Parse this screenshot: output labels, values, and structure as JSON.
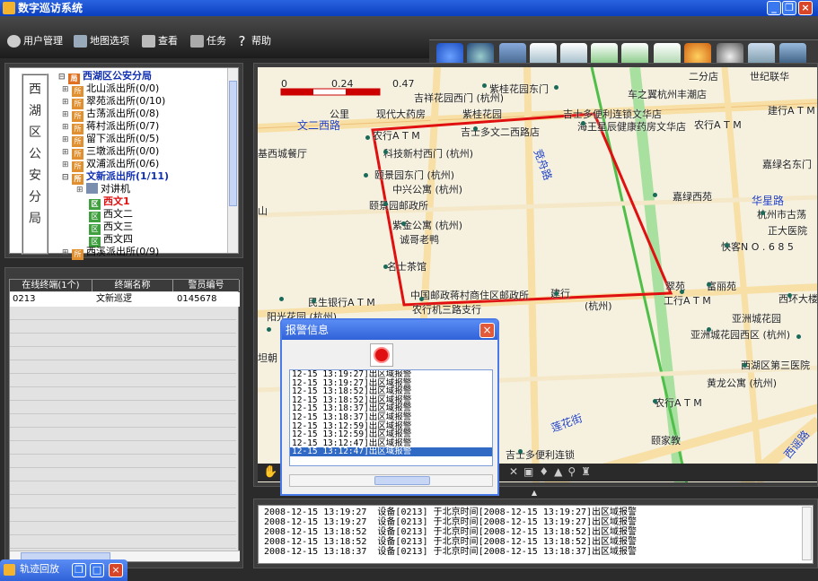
{
  "window": {
    "title": "数字巡访系统"
  },
  "menu": {
    "user_mgmt": "用户管理",
    "map_options": "地图选项",
    "view": "查看",
    "task": "任务",
    "help": "帮助"
  },
  "sidebar": {
    "vertical_label": "西湖区公安分局",
    "root": "西湖区公安分局",
    "items": [
      {
        "label": "北山派出所(0/0)"
      },
      {
        "label": "翠苑派出所(0/10)"
      },
      {
        "label": "古荡派出所(0/8)"
      },
      {
        "label": "蒋村派出所(0/7)"
      },
      {
        "label": "留下派出所(0/5)"
      },
      {
        "label": "三墩派出所(0/0)"
      },
      {
        "label": "双浦派出所(0/6)"
      },
      {
        "label": "文新派出所(1/11)"
      },
      {
        "label": "对讲机"
      },
      {
        "label": "西文1"
      },
      {
        "label": "西文二"
      },
      {
        "label": "西文三"
      },
      {
        "label": "西文四"
      },
      {
        "label": "西溪派出所(0/9)"
      }
    ]
  },
  "terminals": {
    "columns": [
      "在线终端(1个)",
      "终端名称",
      "警员编号"
    ],
    "rows": [
      {
        "id": "0213",
        "name": "文新巡逻",
        "badge": "0145678"
      }
    ]
  },
  "map": {
    "scale": [
      "0",
      "0.24",
      "0.47"
    ],
    "labels": {
      "l1": "公里",
      "l2": "文二西路",
      "l3": "基西城餐厅",
      "l4": "现代大药房",
      "l5": "农行A T M",
      "l6": "科技新村西门 (杭州)",
      "l7": "颐景园东门 (杭州)",
      "l8": "中兴公寓 (杭州)",
      "l9": "颐景园邮政所",
      "l10": "紫金公寓 (杭州)",
      "l11": "诚哥老鸭",
      "l12": "名士茶馆",
      "l13": "民生银行A T M",
      "l14": "中国邮政蒋村商住区邮政所",
      "l15": "建行",
      "l16": "农行机三路支行",
      "l17": "阳光花园 (杭州)",
      "l18": "紫桂花园东门",
      "l19": "吉祥花园西门 (杭州)",
      "l20": "紫桂花园",
      "l21": "吉士多文二西路店",
      "l22": "吉士多便利连锁文华店",
      "l23": "海王星辰健康药房文华店",
      "l24": "车之翼杭州丰潮店",
      "l25": "农行A T M",
      "l26": "建行A T M",
      "l27": "嘉绿西苑",
      "l28": "华星路",
      "l29": "杭州市古荡",
      "l30": "正大医院",
      "l31": "快客N O . 6 8 5",
      "l32": "嘉绿名东门",
      "l33": "竞舟路",
      "l34": "翠苑",
      "l35": "富丽苑",
      "l36": "西环大楼",
      "l37": "工行A T M",
      "l38": "亚洲城花园",
      "l39": "亚洲城花园西区 (杭州)",
      "l40": "西湖区第三医院",
      "l41": "黄龙公寓 (杭州)",
      "l42": "农行A T M",
      "l43": "莲花街",
      "l44": "颐家教",
      "l45": "吉士多便利连锁",
      "l46": "(杭州)",
      "l47": "西谣路",
      "l48": "世纪联华",
      "l49": "二分店",
      "l50": "山",
      "l51": "坦朝"
    }
  },
  "dialog": {
    "title": "报警信息",
    "entries": [
      "12-15 13:19:27]出区域报警",
      "12-15 13:19:27]出区域报警",
      "12-15 13:18:52]出区域报警",
      "12-15 13:18:52]出区域报警",
      "12-15 13:18:37]出区域报警",
      "12-15 13:18:37]出区域报警",
      "12-15 13:12:59]出区域报警",
      "12-15 13:12:59]出区域报警",
      "12-15 13:12:47]出区域报警",
      "12-15 13:12:47]出区域报警"
    ]
  },
  "log": {
    "lines": [
      "2008-12-15 13:19:27  设备[0213] 于北京时间[2008-12-15 13:19:27]出区域报警",
      "2008-12-15 13:19:27  设备[0213] 于北京时间[2008-12-15 13:19:27]出区域报警",
      "2008-12-15 13:18:52  设备[0213] 于北京时间[2008-12-15 13:18:52]出区域报警",
      "2008-12-15 13:18:52  设备[0213] 于北京时间[2008-12-15 13:18:52]出区域报警",
      "2008-12-15 13:18:37  设备[0213] 于北京时间[2008-12-15 13:18:37]出区域报警"
    ]
  },
  "taskbar": {
    "label": "轨迹回放"
  },
  "colors": {
    "accent": "#2f62d8",
    "region": "#e01010",
    "road": "#f2c27a",
    "river": "#7fd67a"
  }
}
